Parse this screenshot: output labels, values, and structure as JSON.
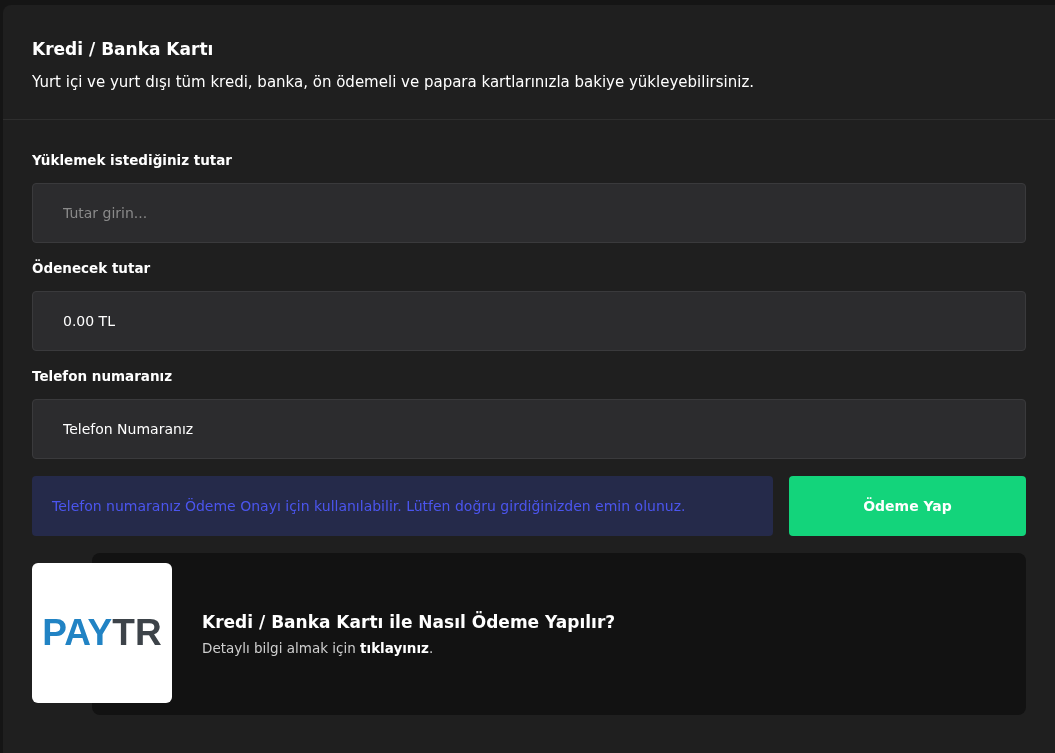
{
  "header": {
    "title": "Kredi / Banka Kartı",
    "subtitle": "Yurt içi ve yurt dışı tüm kredi, banka, ön ödemeli ve papara kartlarınızla bakiye yükleyebilirsiniz."
  },
  "fields": [
    {
      "label": "Yüklemek istediğiniz tutar",
      "placeholder": "Tutar girin..."
    },
    {
      "label": "Ödenecek tutar",
      "value": "0.00 TL"
    },
    {
      "label": "Telefon numaranız",
      "value": "Telefon Numaranız"
    }
  ],
  "notice": "Telefon numaranız Ödeme Onayı için kullanılabilir. Lütfen doğru girdiğinizden emin olunuz.",
  "pay_button": "Ödeme Yap",
  "info": {
    "logo": [
      {
        "text": "PAY",
        "color": "#2183c4"
      },
      {
        "text": "TR",
        "color": "#3d4349"
      }
    ],
    "title": "Kredi / Banka Kartı ile Nasıl Ödeme Yapılır?",
    "text": "Detaylı bilgi almak için **tıklayınız**."
  }
}
